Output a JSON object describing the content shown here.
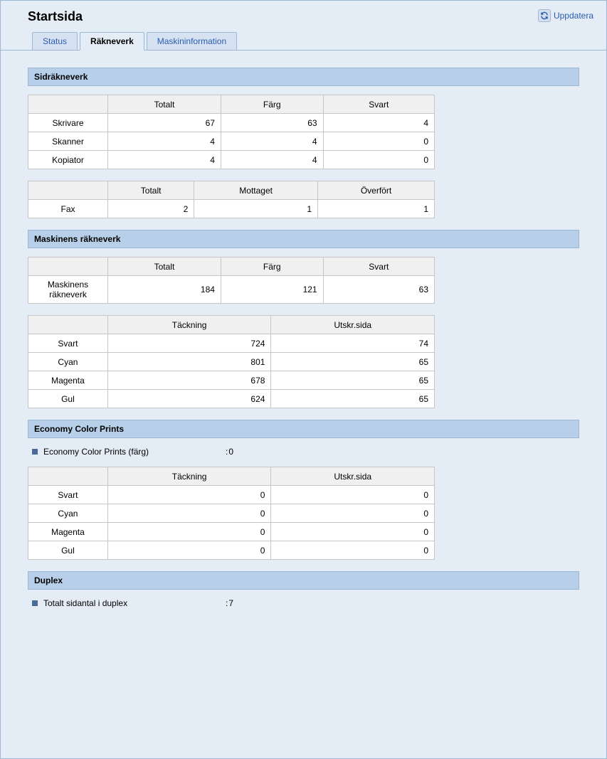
{
  "header": {
    "title": "Startsida",
    "refresh": "Uppdatera"
  },
  "tabs": {
    "status": "Status",
    "raekneverk": "Räkneverk",
    "maskininfo": "Maskininformation"
  },
  "sections": {
    "sidrakneverk": "Sidräkneverk",
    "maskinens": "Maskinens räkneverk",
    "economy": "Economy Color Prints",
    "duplex": "Duplex"
  },
  "cols": {
    "totalt": "Totalt",
    "farg": "Färg",
    "svart": "Svart",
    "mottaget": "Mottaget",
    "overfort": "Överfört",
    "tackning": "Täckning",
    "utskr": "Utskr.sida"
  },
  "table1": {
    "rows": {
      "skrivare": {
        "label": "Skrivare",
        "totalt": "67",
        "farg": "63",
        "svart": "4"
      },
      "skanner": {
        "label": "Skanner",
        "totalt": "4",
        "farg": "4",
        "svart": "0"
      },
      "kopiator": {
        "label": "Kopiator",
        "totalt": "4",
        "farg": "4",
        "svart": "0"
      }
    }
  },
  "table2": {
    "rows": {
      "fax": {
        "label": "Fax",
        "totalt": "2",
        "mottaget": "1",
        "overfort": "1"
      }
    }
  },
  "table3": {
    "rows": {
      "maskin": {
        "label": "Maskinens räkneverk",
        "totalt": "184",
        "farg": "121",
        "svart": "63"
      }
    }
  },
  "table4": {
    "rows": {
      "svart": {
        "label": "Svart",
        "tackning": "724",
        "utskr": "74"
      },
      "cyan": {
        "label": "Cyan",
        "tackning": "801",
        "utskr": "65"
      },
      "magenta": {
        "label": "Magenta",
        "tackning": "678",
        "utskr": "65"
      },
      "gul": {
        "label": "Gul",
        "tackning": "624",
        "utskr": "65"
      }
    }
  },
  "economy_kv": {
    "label": "Economy Color Prints (färg)",
    "value": "0"
  },
  "table5": {
    "rows": {
      "svart": {
        "label": "Svart",
        "tackning": "0",
        "utskr": "0"
      },
      "cyan": {
        "label": "Cyan",
        "tackning": "0",
        "utskr": "0"
      },
      "magenta": {
        "label": "Magenta",
        "tackning": "0",
        "utskr": "0"
      },
      "gul": {
        "label": "Gul",
        "tackning": "0",
        "utskr": "0"
      }
    }
  },
  "duplex_kv": {
    "label": "Totalt sidantal i duplex",
    "value": "7"
  }
}
